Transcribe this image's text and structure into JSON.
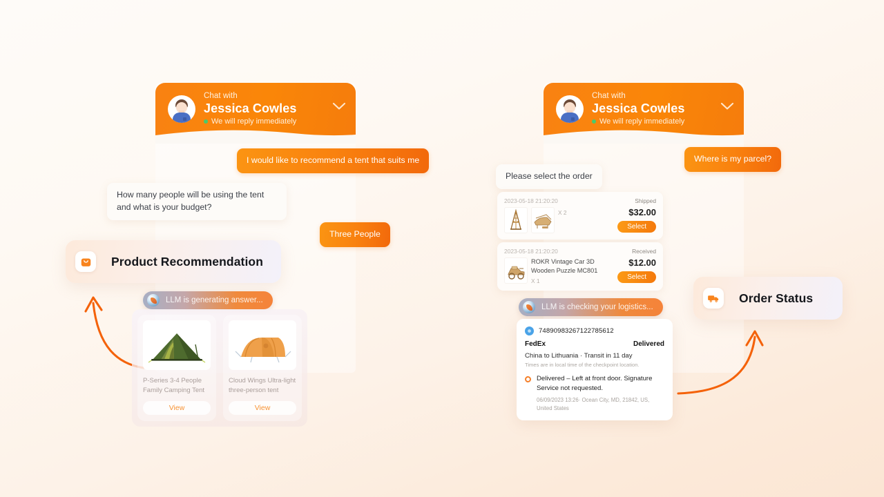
{
  "background": {
    "top_color": "#FDFBF8",
    "bottom_color": "#FBE6D4",
    "accent": "#F5802A"
  },
  "left_flow": {
    "header": {
      "chat_with_label": "Chat with",
      "agent_name": "Jessica Cowles",
      "status": "We will reply immediately",
      "avatar_name": "user-avatar",
      "collapse_icon": "chevron-down-icon"
    },
    "messages": [
      {
        "from": "user",
        "text": "I would like to recommend a tent that suits me"
      },
      {
        "from": "bot",
        "text": "How many people will be using the tent and what is your budget?"
      },
      {
        "from": "user",
        "text": "Three People"
      }
    ],
    "llm_status": "LLM is generating answer...",
    "feature": {
      "label": "Product Recommendation",
      "icon": "shopping-bag-icon"
    },
    "products": [
      {
        "name": "P-Series 3-4 People Family Camping Tent",
        "button": "View",
        "image": "green-dome-tent"
      },
      {
        "name": "Cloud Wings Ultra-light three-person tent",
        "button": "View",
        "image": "orange-tunnel-tent"
      }
    ]
  },
  "right_flow": {
    "header": {
      "chat_with_label": "Chat with",
      "agent_name": "Jessica Cowles",
      "status": "We will reply immediately",
      "avatar_name": "user-avatar",
      "collapse_icon": "chevron-down-icon"
    },
    "messages": [
      {
        "from": "user",
        "text": "Where is my parcel?"
      },
      {
        "from": "bot",
        "text": "Please select the order"
      }
    ],
    "orders": [
      {
        "date": "2023-05-18 21:20:20",
        "status": "Shipped",
        "title": "",
        "qty": "X 2",
        "price": "$32.00",
        "button": "Select",
        "thumbs": [
          "eiffel-tower-puzzle",
          "wooden-piano-puzzle"
        ]
      },
      {
        "date": "2023-05-18 21:20:20",
        "status": "Received",
        "title": "ROKR Vintage Car 3D Wooden Puzzle MC801",
        "qty": "X 1",
        "price": "$12.00",
        "button": "Select",
        "thumbs": [
          "vintage-car-puzzle"
        ]
      }
    ],
    "llm_status": "LLM is checking your logistics...",
    "feature": {
      "label": "Order Status",
      "icon": "delivery-truck-icon"
    },
    "tracking": {
      "tracking_number": "748909832671227856 12",
      "tracking_number_clean": "74890983267122785612",
      "carrier": "FedEx",
      "status": "Delivered",
      "route": "China to Lithuania · Transit in 11 day",
      "note": "Times are in local time of the checkpoint location.",
      "event_title": "Delivered – Left at front door. Signature Service not requested.",
      "event_meta": "06/09/2023 13:26· Ocean City, MD, 21842, US, United States"
    }
  }
}
